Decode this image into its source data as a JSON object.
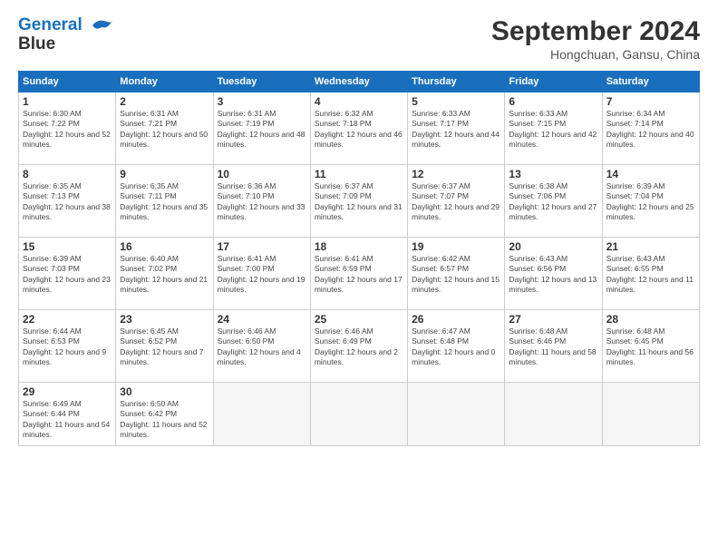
{
  "header": {
    "logo_line1": "General",
    "logo_line2": "Blue",
    "month": "September 2024",
    "location": "Hongchuan, Gansu, China"
  },
  "days_of_week": [
    "Sunday",
    "Monday",
    "Tuesday",
    "Wednesday",
    "Thursday",
    "Friday",
    "Saturday"
  ],
  "weeks": [
    [
      {
        "num": "1",
        "rise": "6:30 AM",
        "set": "7:22 PM",
        "daylight": "12 hours and 52 minutes."
      },
      {
        "num": "2",
        "rise": "6:31 AM",
        "set": "7:21 PM",
        "daylight": "12 hours and 50 minutes."
      },
      {
        "num": "3",
        "rise": "6:31 AM",
        "set": "7:19 PM",
        "daylight": "12 hours and 48 minutes."
      },
      {
        "num": "4",
        "rise": "6:32 AM",
        "set": "7:18 PM",
        "daylight": "12 hours and 46 minutes."
      },
      {
        "num": "5",
        "rise": "6:33 AM",
        "set": "7:17 PM",
        "daylight": "12 hours and 44 minutes."
      },
      {
        "num": "6",
        "rise": "6:33 AM",
        "set": "7:15 PM",
        "daylight": "12 hours and 42 minutes."
      },
      {
        "num": "7",
        "rise": "6:34 AM",
        "set": "7:14 PM",
        "daylight": "12 hours and 40 minutes."
      }
    ],
    [
      {
        "num": "8",
        "rise": "6:35 AM",
        "set": "7:13 PM",
        "daylight": "12 hours and 38 minutes."
      },
      {
        "num": "9",
        "rise": "6:35 AM",
        "set": "7:11 PM",
        "daylight": "12 hours and 35 minutes."
      },
      {
        "num": "10",
        "rise": "6:36 AM",
        "set": "7:10 PM",
        "daylight": "12 hours and 33 minutes."
      },
      {
        "num": "11",
        "rise": "6:37 AM",
        "set": "7:09 PM",
        "daylight": "12 hours and 31 minutes."
      },
      {
        "num": "12",
        "rise": "6:37 AM",
        "set": "7:07 PM",
        "daylight": "12 hours and 29 minutes."
      },
      {
        "num": "13",
        "rise": "6:38 AM",
        "set": "7:06 PM",
        "daylight": "12 hours and 27 minutes."
      },
      {
        "num": "14",
        "rise": "6:39 AM",
        "set": "7:04 PM",
        "daylight": "12 hours and 25 minutes."
      }
    ],
    [
      {
        "num": "15",
        "rise": "6:39 AM",
        "set": "7:03 PM",
        "daylight": "12 hours and 23 minutes."
      },
      {
        "num": "16",
        "rise": "6:40 AM",
        "set": "7:02 PM",
        "daylight": "12 hours and 21 minutes."
      },
      {
        "num": "17",
        "rise": "6:41 AM",
        "set": "7:00 PM",
        "daylight": "12 hours and 19 minutes."
      },
      {
        "num": "18",
        "rise": "6:41 AM",
        "set": "6:59 PM",
        "daylight": "12 hours and 17 minutes."
      },
      {
        "num": "19",
        "rise": "6:42 AM",
        "set": "6:57 PM",
        "daylight": "12 hours and 15 minutes."
      },
      {
        "num": "20",
        "rise": "6:43 AM",
        "set": "6:56 PM",
        "daylight": "12 hours and 13 minutes."
      },
      {
        "num": "21",
        "rise": "6:43 AM",
        "set": "6:55 PM",
        "daylight": "12 hours and 11 minutes."
      }
    ],
    [
      {
        "num": "22",
        "rise": "6:44 AM",
        "set": "6:53 PM",
        "daylight": "12 hours and 9 minutes."
      },
      {
        "num": "23",
        "rise": "6:45 AM",
        "set": "6:52 PM",
        "daylight": "12 hours and 7 minutes."
      },
      {
        "num": "24",
        "rise": "6:46 AM",
        "set": "6:50 PM",
        "daylight": "12 hours and 4 minutes."
      },
      {
        "num": "25",
        "rise": "6:46 AM",
        "set": "6:49 PM",
        "daylight": "12 hours and 2 minutes."
      },
      {
        "num": "26",
        "rise": "6:47 AM",
        "set": "6:48 PM",
        "daylight": "12 hours and 0 minutes."
      },
      {
        "num": "27",
        "rise": "6:48 AM",
        "set": "6:46 PM",
        "daylight": "11 hours and 58 minutes."
      },
      {
        "num": "28",
        "rise": "6:48 AM",
        "set": "6:45 PM",
        "daylight": "11 hours and 56 minutes."
      }
    ],
    [
      {
        "num": "29",
        "rise": "6:49 AM",
        "set": "6:44 PM",
        "daylight": "11 hours and 54 minutes."
      },
      {
        "num": "30",
        "rise": "6:50 AM",
        "set": "6:42 PM",
        "daylight": "11 hours and 52 minutes."
      },
      null,
      null,
      null,
      null,
      null
    ]
  ]
}
